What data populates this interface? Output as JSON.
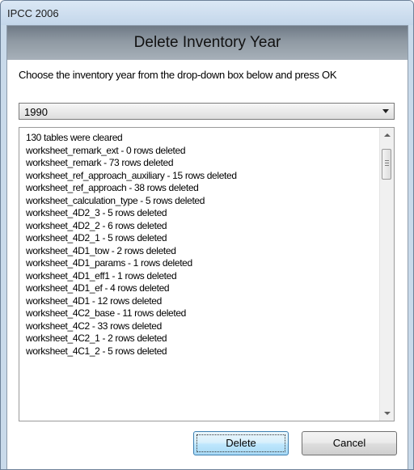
{
  "window": {
    "title": "IPCC 2006"
  },
  "header": {
    "title": "Delete Inventory Year"
  },
  "instruction": "Choose the inventory year from the drop-down box below and press OK",
  "year_select": {
    "selected": "1990"
  },
  "log_lines": [
    "130 tables were cleared",
    "worksheet_remark_ext - 0 rows deleted",
    "worksheet_remark - 73 rows deleted",
    "worksheet_ref_approach_auxiliary - 15 rows deleted",
    "worksheet_ref_approach - 38 rows deleted",
    "worksheet_calculation_type - 5 rows deleted",
    "worksheet_4D2_3 - 5 rows deleted",
    "worksheet_4D2_2 - 6 rows deleted",
    "worksheet_4D2_1 - 5 rows deleted",
    "worksheet_4D1_tow - 2 rows deleted",
    "worksheet_4D1_params - 1 rows deleted",
    "worksheet_4D1_eff1 - 1 rows deleted",
    "worksheet_4D1_ef - 4 rows deleted",
    "worksheet_4D1 - 12 rows deleted",
    "worksheet_4C2_base - 11 rows deleted",
    "worksheet_4C2 - 33 rows deleted",
    "worksheet_4C2_1 - 2 rows deleted",
    "worksheet_4C1_2 - 5 rows deleted"
  ],
  "buttons": {
    "delete": "Delete",
    "cancel": "Cancel"
  }
}
